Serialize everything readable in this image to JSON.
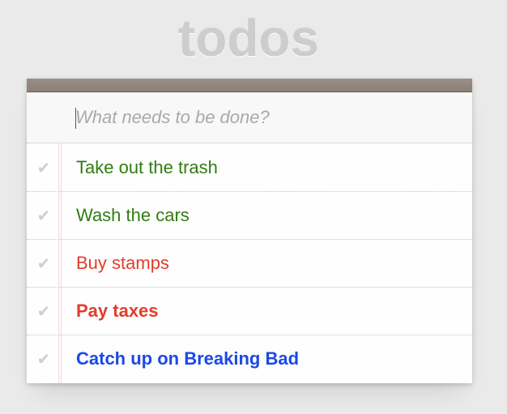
{
  "app": {
    "title": "todos"
  },
  "new_todo": {
    "placeholder": "What needs to be done?",
    "value": ""
  },
  "todos": [
    {
      "text": "Take out the trash",
      "color": "#2f7d12",
      "bold": false
    },
    {
      "text": "Wash the cars",
      "color": "#2f7d12",
      "bold": false
    },
    {
      "text": "Buy stamps",
      "color": "#e23d2a",
      "bold": false
    },
    {
      "text": "Pay taxes",
      "color": "#e23d2a",
      "bold": true
    },
    {
      "text": "Catch up on Breaking Bad",
      "color": "#1a49e6",
      "bold": true
    }
  ],
  "icons": {
    "toggle": "check-mark-icon",
    "toggle_glyph": "✔"
  },
  "colors": {
    "background": "#eaeaea",
    "topbar": "#958982",
    "title": "#cdcdcd"
  }
}
